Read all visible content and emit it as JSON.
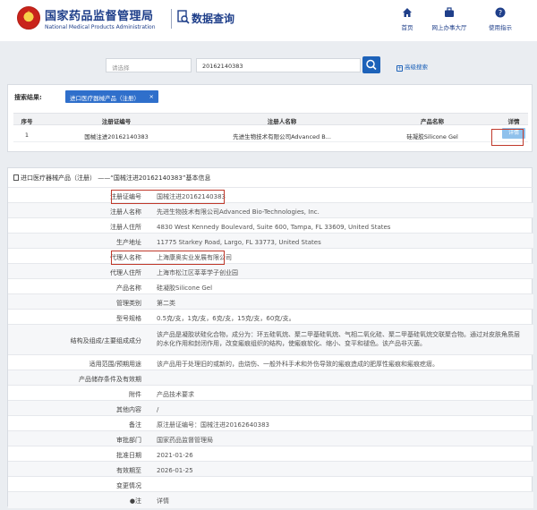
{
  "header": {
    "agency_cn": "国家药品监督管理局",
    "agency_en": "National Medical Products Administration",
    "section_title": "数据查询",
    "nav": [
      {
        "label": "首页",
        "icon": "home-icon"
      },
      {
        "label": "网上办事大厅",
        "icon": "briefcase-icon"
      },
      {
        "label": "使用指示",
        "icon": "help-icon"
      }
    ]
  },
  "search": {
    "select_placeholder": "请选择",
    "query_value": "20162140383",
    "advanced_label": "高级搜索"
  },
  "results": {
    "label": "搜索结果:",
    "filter_tag": "进口医疗器械产品（注册）",
    "columns": [
      "序号",
      "注册证编号",
      "注册人名称",
      "产品名称",
      "详情"
    ],
    "row": {
      "index": "1",
      "reg_no": "国械注进20162140383",
      "registrant": "先进生物技术有限公司Advanced B...",
      "product": "硅凝胶Silicone Gel",
      "detail_button": "详情"
    }
  },
  "detail": {
    "title": "进口医疗器械产品（注册） ——“国械注进20162140383”基本信息",
    "rows": [
      {
        "label": "注册证编号",
        "value": "国械注进20162140383"
      },
      {
        "label": "注册人名称",
        "value": "先进生物技术有限公司Advanced Bio-Technologies, Inc."
      },
      {
        "label": "注册人住所",
        "value": "4830 West Kennedy Boulevard, Suite 600, Tampa, FL 33609, United States"
      },
      {
        "label": "生产地址",
        "value": "11775 Starkey Road, Largo, FL 33773, United States"
      },
      {
        "label": "代理人名称",
        "value": "上海康奥实业发展有限公司"
      },
      {
        "label": "代理人住所",
        "value": "上海市松江区莘莘学子创业园"
      },
      {
        "label": "产品名称",
        "value": "硅凝胶Silicone Gel"
      },
      {
        "label": "管理类别",
        "value": "第二类"
      },
      {
        "label": "型号规格",
        "value": "0.5克/支，1克/支，6克/支，15克/支，60克/支。"
      },
      {
        "label": "结构及组成/主要组成成分",
        "value": "该产品是凝胶状硅化合物，成分为：环五硅氧烷、聚二甲基硅氧烷、气相二氧化硅、聚二甲基硅氧烷交联聚合物。通过对皮肤角质层的水化作用和封闭作用，改变瘢痕组织的结构，使瘢痕软化、缩小、变平和褪色。该产品非灭菌。"
      },
      {
        "label": "适用范围/预期用途",
        "value": "该产品用于处理旧的或新的，由烧伤、一般外科手术和外伤导致的瘢痕造成的肥厚性瘢痕和瘢痕疙瘩。"
      },
      {
        "label": "产品储存条件及有效期",
        "value": ""
      },
      {
        "label": "附件",
        "value": "产品技术要求"
      },
      {
        "label": "其他内容",
        "value": "/"
      },
      {
        "label": "备注",
        "value": "原注册证编号：国械注进20162640383"
      },
      {
        "label": "审批部门",
        "value": "国家药品监督管理局"
      },
      {
        "label": "批准日期",
        "value": "2021-01-26"
      },
      {
        "label": "有效期至",
        "value": "2026-01-25"
      },
      {
        "label": "变更情况",
        "value": ""
      },
      {
        "label": "●注",
        "value": "详情"
      }
    ]
  },
  "colors": {
    "brand_blue": "#1f3f8a",
    "button_blue": "#1d62b9",
    "highlight_red": "#c0392b"
  }
}
